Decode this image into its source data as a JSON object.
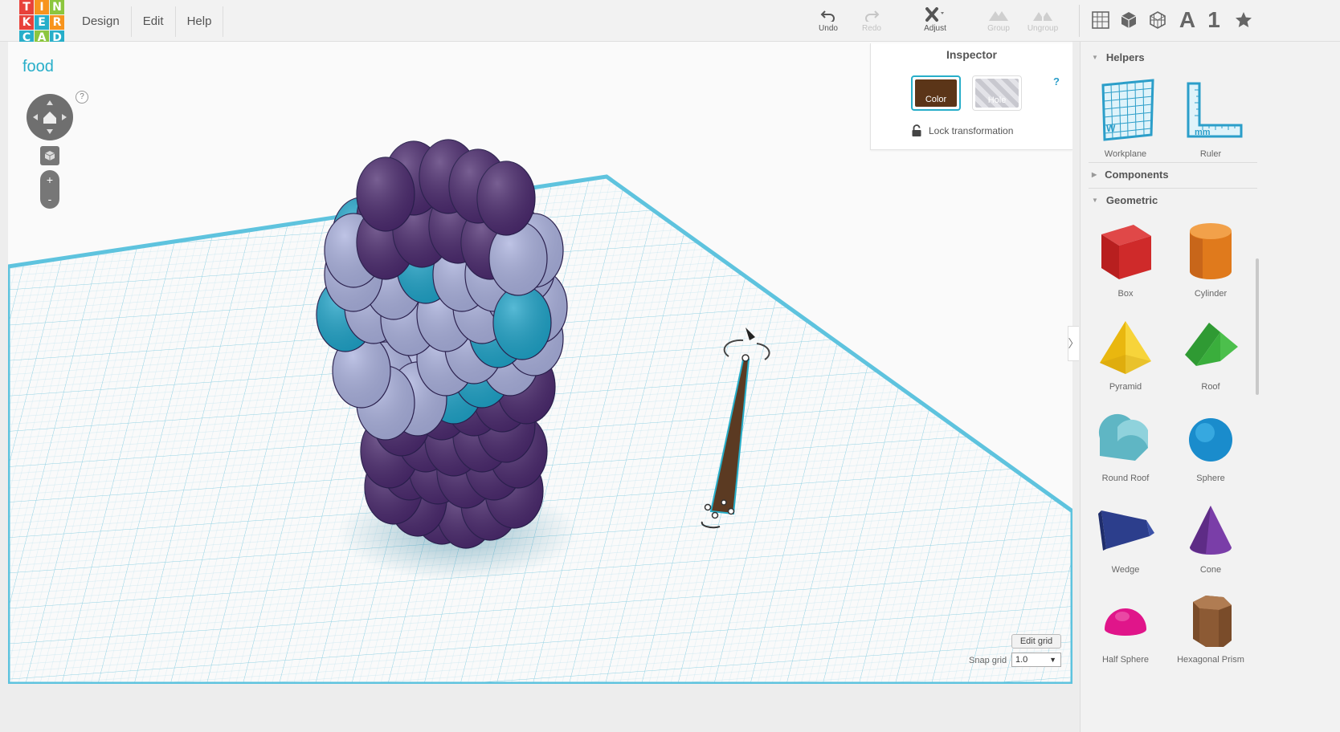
{
  "logo": {
    "letters": [
      "T",
      "I",
      "N",
      "K",
      "E",
      "R",
      "C",
      "A",
      "D"
    ],
    "colors": [
      "#e8413a",
      "#f7941e",
      "#8cc63e",
      "#e8413a",
      "#27aec9",
      "#f7941e",
      "#27aec9",
      "#8cc63e",
      "#27aec9"
    ]
  },
  "menu": {
    "design": "Design",
    "edit": "Edit",
    "help": "Help"
  },
  "toolbar": {
    "undo": "Undo",
    "redo": "Redo",
    "adjust": "Adjust",
    "group": "Group",
    "ungroup": "Ungroup"
  },
  "right_tools": {
    "font_icon_label": "A",
    "number_icon_label": "1"
  },
  "project": {
    "title": "food"
  },
  "view_controls": {
    "help": "?",
    "zoom_in": "+",
    "zoom_out": "-"
  },
  "inspector": {
    "title": "Inspector",
    "help": "?",
    "color_label": "Color",
    "hole_label": "Hole",
    "lock_label": "Lock transformation",
    "selected_color": "#5b3518"
  },
  "grid": {
    "edit_label": "Edit grid",
    "snap_label": "Snap grid",
    "snap_value": "1.0"
  },
  "panel": {
    "helpers_title": "Helpers",
    "components_title": "Components",
    "geometric_title": "Geometric",
    "helpers": [
      {
        "label": "Workplane"
      },
      {
        "label": "Ruler"
      }
    ],
    "shapes": [
      {
        "label": "Box",
        "color": "#d42a2a"
      },
      {
        "label": "Cylinder",
        "color": "#e87a1e"
      },
      {
        "label": "Pyramid",
        "color": "#f5c518"
      },
      {
        "label": "Roof",
        "color": "#3aa63a"
      },
      {
        "label": "Round Roof",
        "color": "#6cc0cc"
      },
      {
        "label": "Sphere",
        "color": "#1e9ad6"
      },
      {
        "label": "Wedge",
        "color": "#2d3f8f"
      },
      {
        "label": "Cone",
        "color": "#7b3fa6"
      },
      {
        "label": "Half Sphere",
        "color": "#e0158a"
      },
      {
        "label": "Hexagonal Prism",
        "color": "#8a5a34"
      }
    ]
  },
  "scene": {
    "object_colors": {
      "dark_purple": "#4b2a6e",
      "lavender": "#a9b0dd",
      "teal": "#1fa3c8",
      "brown_stick": "#5b3a22"
    }
  }
}
